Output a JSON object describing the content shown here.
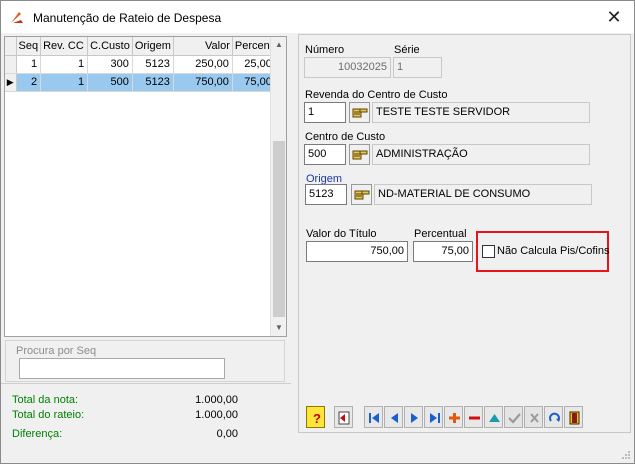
{
  "window": {
    "title": "Manutenção de Rateio de Despesa",
    "close_label": "✕"
  },
  "grid": {
    "columns": [
      "Seq",
      "Rev. CC",
      "C.Custo",
      "Origem",
      "Valor",
      "Percent"
    ],
    "rows": [
      [
        "1",
        "1",
        "300",
        "5123",
        "250,00",
        "25,00"
      ],
      [
        "2",
        "1",
        "500",
        "5123",
        "750,00",
        "75,00"
      ]
    ],
    "selected_row": 2,
    "current_row_marker": "▶"
  },
  "search": {
    "label": "Procura por Seq",
    "value": ""
  },
  "totals": {
    "nota_label": "Total da nota:",
    "nota_value": "1.000,00",
    "rateio_label": "Total do rateio:",
    "rateio_value": "1.000,00",
    "diferenca_label": "Diferença:",
    "diferenca_value": "0,00"
  },
  "form": {
    "numero_label": "Número",
    "numero_value": "10032025",
    "serie_label": "Série",
    "serie_value": "1",
    "revenda_label": "Revenda do Centro de Custo",
    "revenda_code": "1",
    "revenda_desc": "TESTE TESTE SERVIDOR",
    "centro_label": "Centro de Custo",
    "centro_code": "500",
    "centro_desc": "ADMINISTRAÇÃO",
    "origem_label": "Origem",
    "origem_code": "5123",
    "origem_desc": "ND-MATERIAL DE CONSUMO",
    "valor_label": "Valor do Título",
    "valor_value": "750,00",
    "percentual_label": "Percentual",
    "percentual_value": "75,00",
    "pis_cofins_label": "Não Calcula Pis/Cofins",
    "pis_cofins_checked": false
  },
  "toolbar_icons": [
    "help-icon",
    "report-icon",
    "first-icon",
    "prior-icon",
    "next-icon",
    "last-icon",
    "insert-icon",
    "delete-icon",
    "edit-icon",
    "post-icon",
    "cancel-icon",
    "refresh-icon",
    "exit-icon"
  ],
  "colors": {
    "selected_row": "#99c9ef",
    "totals_label": "#008000",
    "highlight_border": "#e8141c",
    "origem_label": "#1a3aa8"
  }
}
